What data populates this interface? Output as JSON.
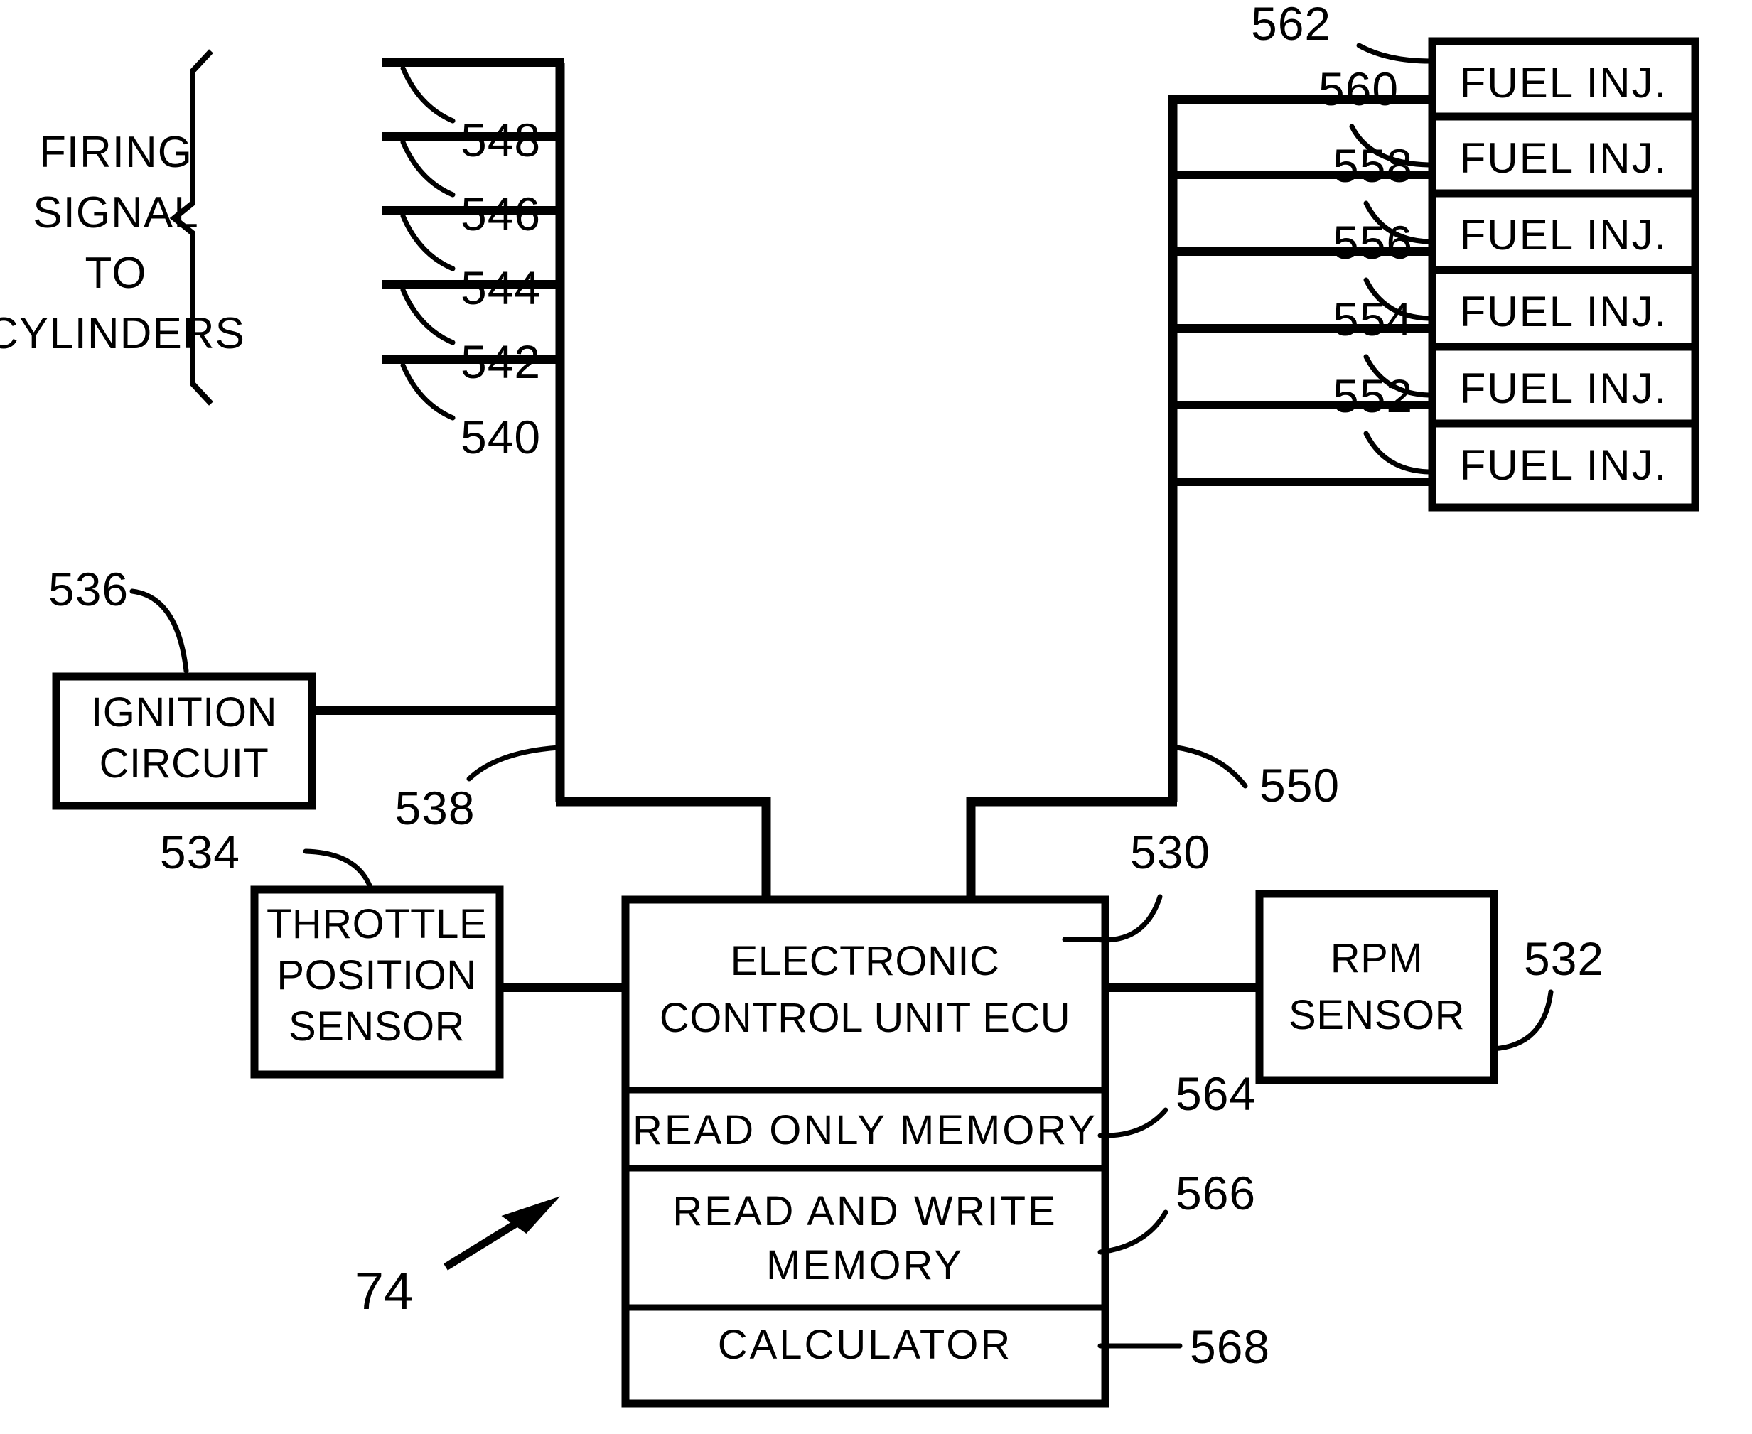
{
  "figure": {
    "figure_number": "74",
    "bracket_label_lines": [
      "FIRING",
      "SIGNAL",
      "TO",
      "CYLINDERS"
    ],
    "ignition_bus_ref": "538",
    "injector_bus_ref": "550"
  },
  "firing_signal_refs": [
    {
      "ref": "548"
    },
    {
      "ref": "546"
    },
    {
      "ref": "544"
    },
    {
      "ref": "542"
    },
    {
      "ref": "540"
    }
  ],
  "fuel_injectors": [
    {
      "ref": "562",
      "label": "FUEL INJ."
    },
    {
      "ref": "560",
      "label": "FUEL INJ."
    },
    {
      "ref": "558",
      "label": "FUEL INJ."
    },
    {
      "ref": "556",
      "label": "FUEL INJ."
    },
    {
      "ref": "554",
      "label": "FUEL INJ."
    },
    {
      "ref": "552",
      "label": "FUEL INJ."
    }
  ],
  "ignition_circuit": {
    "ref": "536",
    "line1": "IGNITION",
    "line2": "CIRCUIT"
  },
  "throttle_sensor": {
    "ref": "534",
    "line1": "THROTTLE",
    "line2": "POSITION",
    "line3": "SENSOR"
  },
  "rpm_sensor": {
    "ref": "532",
    "line1": "RPM",
    "line2": "SENSOR"
  },
  "ecu": {
    "ref": "530",
    "title_line1": "ELECTRONIC",
    "title_line2": "CONTROL UNIT ECU",
    "blocks": [
      {
        "ref": "564",
        "line1": "READ  ONLY  MEMORY",
        "line2": ""
      },
      {
        "ref": "566",
        "line1": "READ  AND  WRITE",
        "line2": "MEMORY"
      },
      {
        "ref": "568",
        "line1": "CALCULATOR",
        "line2": ""
      }
    ]
  },
  "colors": {
    "ink": "#000000",
    "paper": "#ffffff"
  }
}
